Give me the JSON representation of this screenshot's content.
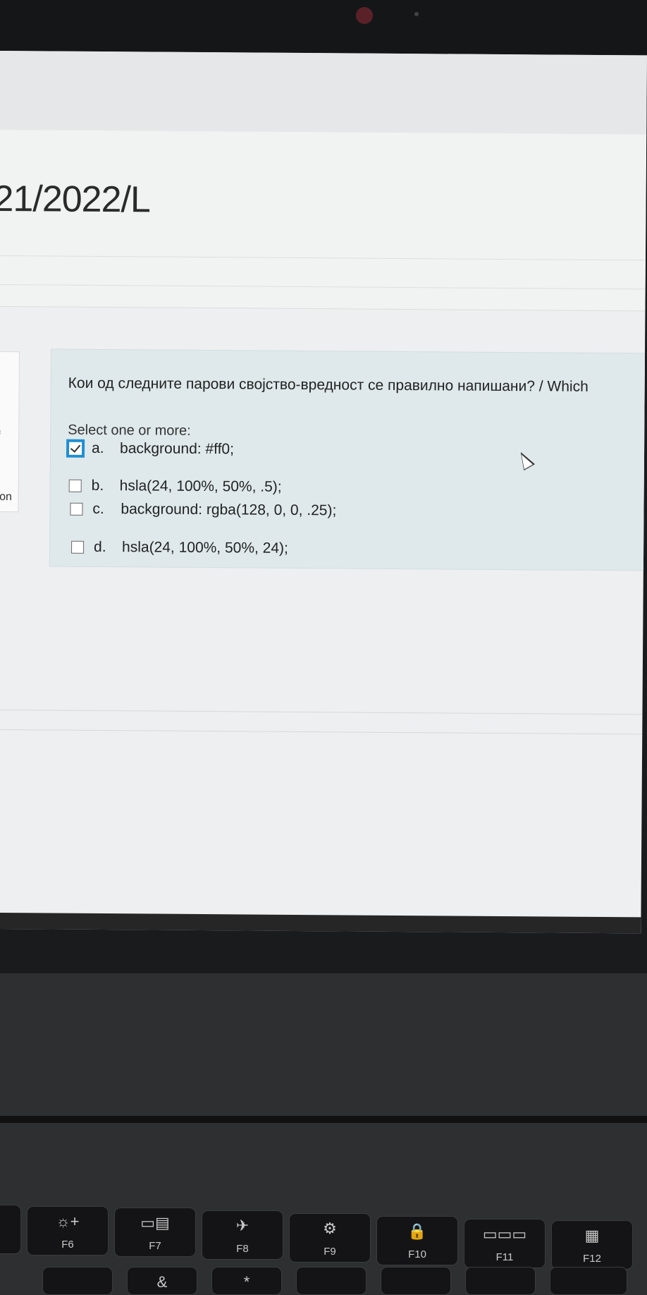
{
  "course": {
    "title": "21/2022/L"
  },
  "sidebar": {
    "fragment_f": "f",
    "fragment_ion": "ion"
  },
  "question": {
    "text": "Кои од следните парови својство-вредност се правилно напишани? / Which",
    "prompt": "Select one or more:",
    "options": [
      {
        "letter": "a.",
        "text": "background: #ff0;",
        "checked": true
      },
      {
        "letter": "b.",
        "text": "hsla(24, 100%, 50%, .5);",
        "checked": false
      },
      {
        "letter": "c.",
        "text": "background: rgba(128, 0, 0, .25);",
        "checked": false
      },
      {
        "letter": "d.",
        "text": "hsla(24, 100%, 50%, 24);",
        "checked": false
      }
    ]
  },
  "keyboard": {
    "keys": [
      {
        "fn": "F6",
        "icon": "brightness-up-icon",
        "glyph": "☼+"
      },
      {
        "fn": "F7",
        "icon": "display-switch-icon",
        "glyph": "▭▤"
      },
      {
        "fn": "F8",
        "icon": "airplane-mode-icon",
        "glyph": "✈"
      },
      {
        "fn": "F9",
        "icon": "settings-gear-icon",
        "glyph": "⚙"
      },
      {
        "fn": "F10",
        "icon": "lock-icon",
        "glyph": "🔒"
      },
      {
        "fn": "F11",
        "icon": "keyboard-backlight-icon",
        "glyph": "▭▭▭"
      },
      {
        "fn": "F12",
        "icon": "calculator-icon",
        "glyph": "▦"
      }
    ],
    "lower_glyphs": [
      "&",
      "*"
    ]
  },
  "colors": {
    "accent_checkbox": "#1f8fd3",
    "question_bg": "#dfe9ec"
  }
}
